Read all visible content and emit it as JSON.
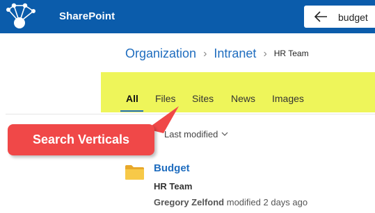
{
  "header": {
    "app_title": "SharePoint",
    "logo_icon": "sharepoint-network-logo-icon",
    "back_icon": "arrow-left-icon",
    "search_value": "budget",
    "brand_color": "#0b5cab"
  },
  "breadcrumb": {
    "items": [
      "Organization",
      "Intranet"
    ],
    "separator": "›",
    "current": "HR Team"
  },
  "verticals": {
    "tabs": [
      "All",
      "Files",
      "Sites",
      "News",
      "Images"
    ],
    "active": "All",
    "highlight_color": "#eef55a"
  },
  "sort": {
    "label": "Last modified",
    "icon": "chevron-down-icon"
  },
  "callout": {
    "text": "Search Verticals",
    "color": "#f04848"
  },
  "results": [
    {
      "icon": "folder-icon",
      "title": "Budget",
      "site": "HR Team",
      "author": "Gregory Zelfond",
      "meta": "modified 2 days ago"
    }
  ]
}
